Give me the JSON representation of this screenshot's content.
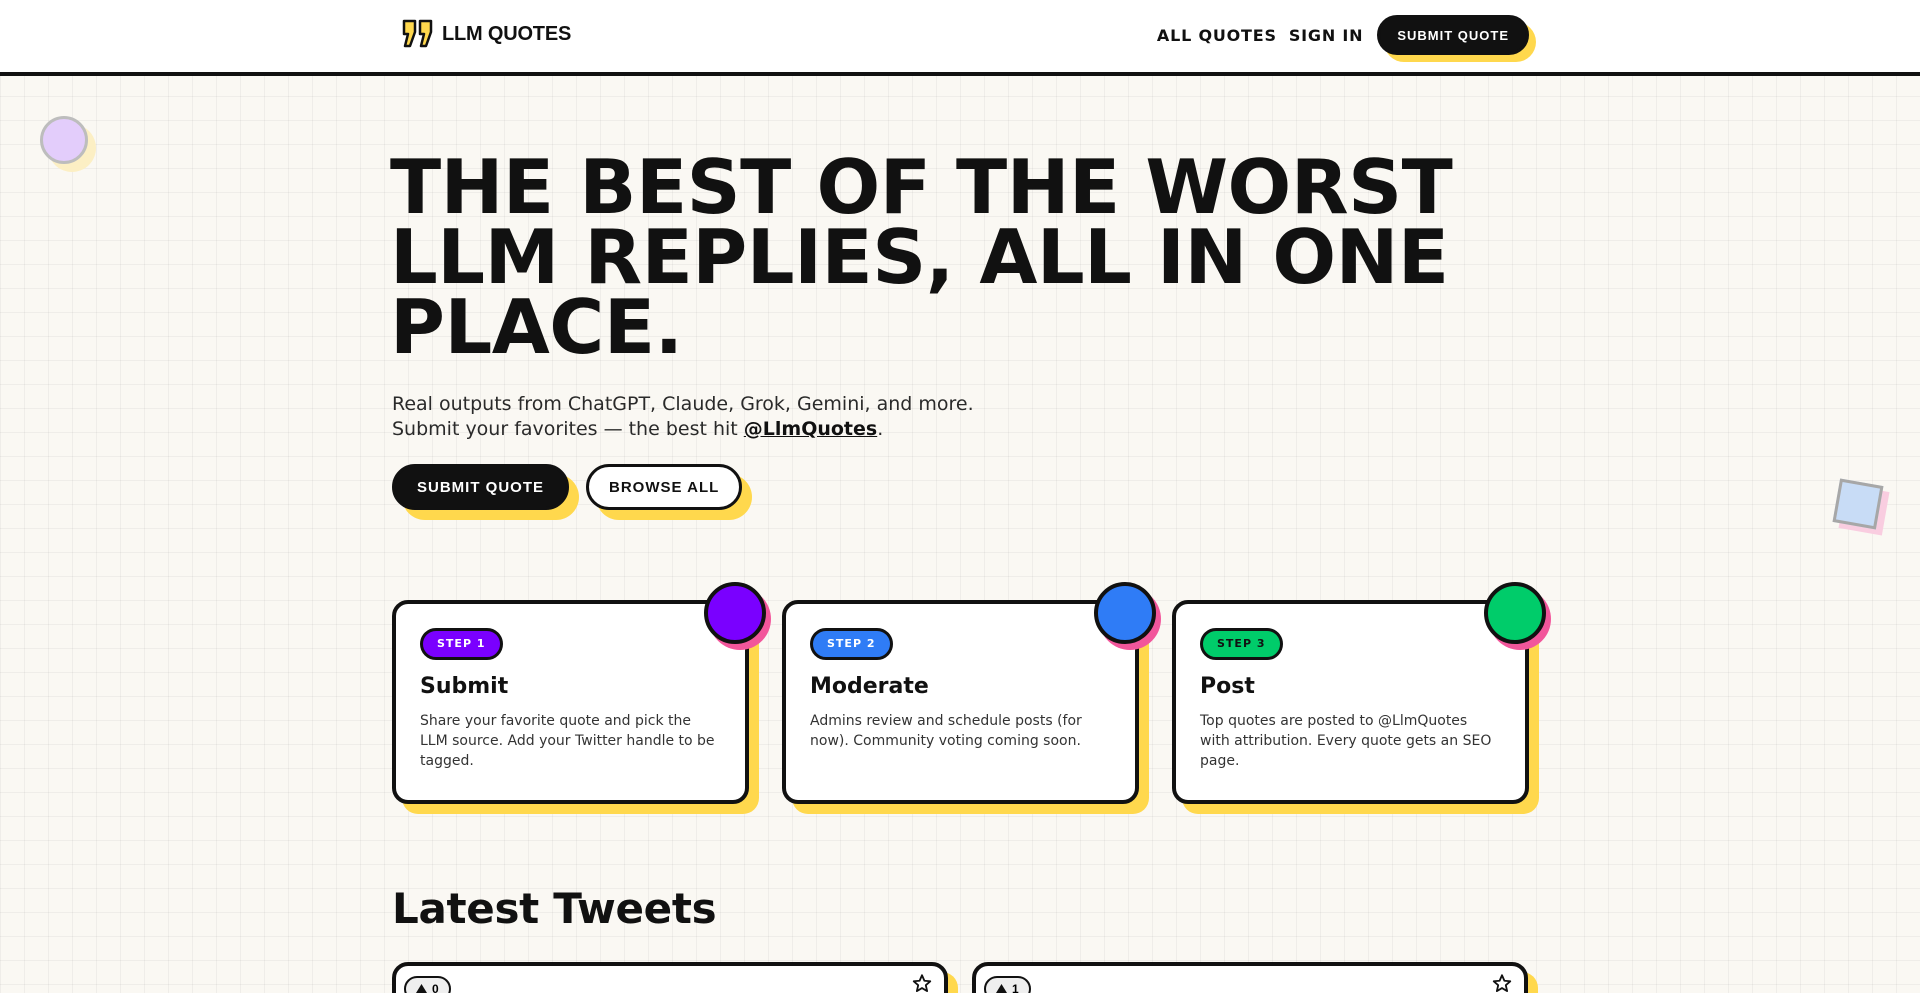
{
  "header": {
    "logo_text": "LLM QUOTES",
    "logo_icon": "quote-marks-icon",
    "nav": {
      "all_quotes": "ALL QUOTES",
      "sign_in": "SIGN IN",
      "submit": "SUBMIT QUOTE"
    }
  },
  "hero": {
    "title_lines": [
      "THE BEST OF THE WORST",
      "LLM REPLIES, ALL IN ONE",
      "PLACE."
    ],
    "subtitle_line1": "Real outputs from ChatGPT, Claude, Grok, Gemini, and more.",
    "subtitle_line2_pre": "Submit your favorites — the best hit ",
    "subtitle_handle": "@LlmQuotes",
    "subtitle_line2_post": ".",
    "primary_button": "SUBMIT QUOTE",
    "secondary_button": "BROWSE ALL"
  },
  "steps": [
    {
      "badge": "STEP 1",
      "title": "Submit",
      "description": "Share your favorite quote and pick the LLM source. Add your Twitter handle to be tagged.",
      "color": "#7a00ff"
    },
    {
      "badge": "STEP 2",
      "title": "Moderate",
      "description": "Admins review and schedule posts (for now). Community voting coming soon.",
      "color": "#2f7cf6"
    },
    {
      "badge": "STEP 3",
      "title": "Post",
      "description": "Top quotes are posted to @LlmQuotes with attribution. Every quote gets an SEO page.",
      "color": "#00cc6a"
    }
  ],
  "latest": {
    "title": "Latest Tweets",
    "tweets": [
      {
        "votes": "0",
        "vote_icon": "triangle-up-icon",
        "fav_icon": "star-icon"
      },
      {
        "votes": "1",
        "vote_icon": "triangle-up-icon",
        "fav_icon": "star-icon"
      }
    ]
  },
  "colors": {
    "accent_yellow": "#ffd84d",
    "ink": "#111111",
    "pink": "#f2569b",
    "background": "#faf8f3"
  }
}
